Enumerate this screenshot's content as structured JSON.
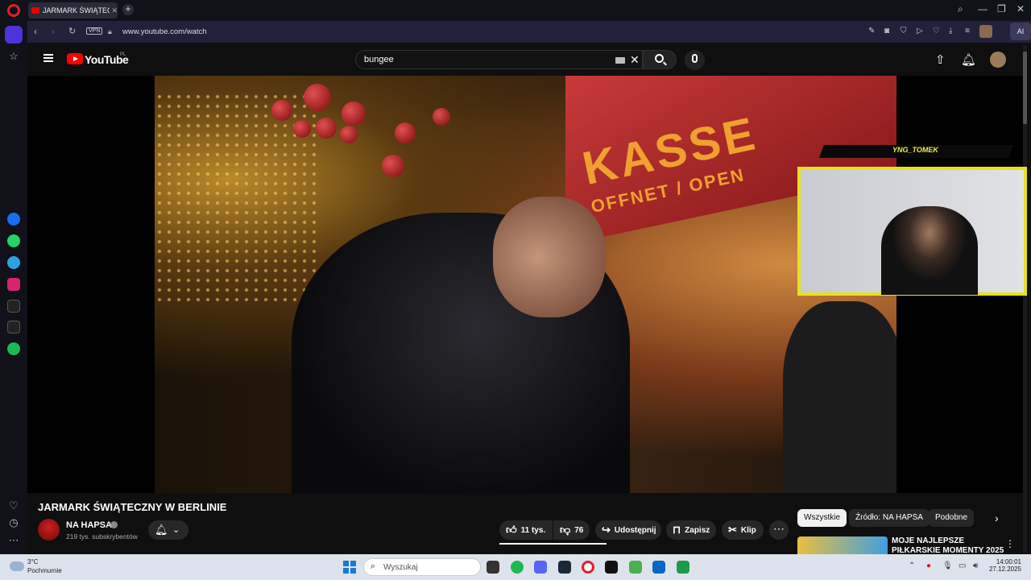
{
  "browser": {
    "tab_title": "JARMARK ŚWIĄTECZNY W",
    "url": "www.youtube.com/watch",
    "vpn_label": "VPN",
    "ai_label": "AI"
  },
  "youtube": {
    "logo_text": "YouTube",
    "region": "PL",
    "search_query": "bungee"
  },
  "overlay": {
    "streamer_name": "YNG_TOMEK"
  },
  "video_content": {
    "sign_text": "KASSE",
    "sign_subtext": "OFFNET / OPEN"
  },
  "video": {
    "title": "JARMARK ŚWIĄTECZNY W BERLINIE",
    "channel_name": "NA HAPSA",
    "subscribers": "219 tys. subskrybentów",
    "likes": "11 tys.",
    "dislikes": "76",
    "share_label": "Udostępnij",
    "save_label": "Zapisz",
    "clip_label": "Klip"
  },
  "chips": {
    "all": "Wszystkie",
    "source": "Źródło: NA HAPSA",
    "similar": "Podobne"
  },
  "recommendation": {
    "title": "MOJE NAJLEPSZE PIŁKARSKIE MOMENTY 2025"
  },
  "taskbar": {
    "temperature": "3°C",
    "weather": "Pochmurnie",
    "search_placeholder": "Wyszukaj",
    "time": "14:00:01",
    "date": "27.12.2025"
  },
  "colors": {
    "youtube_red": "#ff0000",
    "overlay_yellow": "#e8e020",
    "opera_accent": "#4b35d8"
  }
}
